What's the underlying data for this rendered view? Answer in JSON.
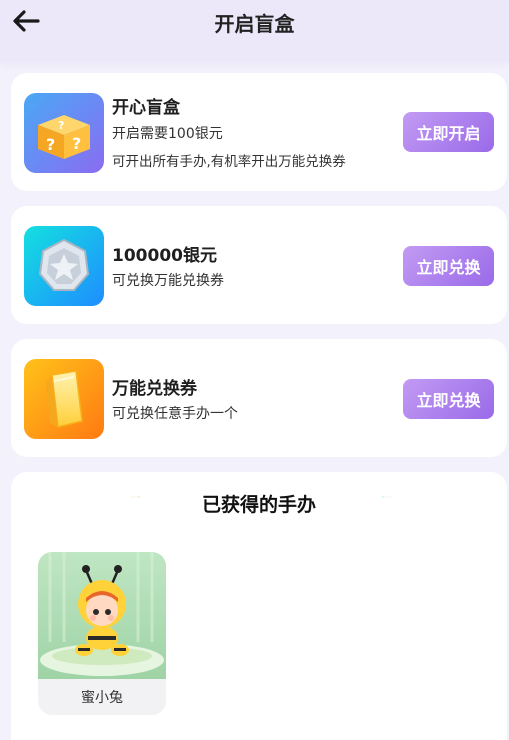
{
  "header": {
    "title": "开启盲盒",
    "back_icon": "arrow-left-icon"
  },
  "cards": [
    {
      "title": "开心盲盒",
      "lines": [
        "开启需要100银元",
        "可开出所有手办,有机率开出万能兑换券"
      ],
      "button": "立即开启",
      "icon": "mystery-box-icon",
      "icon_colors": [
        "#4aa8f5",
        "#8a6cf2"
      ]
    },
    {
      "title": "100000银元",
      "lines": [
        "可兑换万能兑换券"
      ],
      "button": "立即兑换",
      "icon": "silver-coin-icon",
      "icon_colors": [
        "#14e0e0",
        "#1e8dff"
      ]
    },
    {
      "title": "万能兑换券",
      "lines": [
        "可兑换任意手办一个"
      ],
      "button": "立即兑换",
      "icon": "golden-ticket-icon",
      "icon_colors": [
        "#ffc21a",
        "#ff7a12"
      ]
    }
  ],
  "collection": {
    "title": "已获得的手办",
    "items": [
      {
        "name": "蜜小兔",
        "icon": "bee-doll-figure"
      }
    ]
  },
  "colors": {
    "accent_purple": "#a67ced",
    "header_bg": "#ece8fa",
    "page_bg": "#f3f1fb"
  }
}
